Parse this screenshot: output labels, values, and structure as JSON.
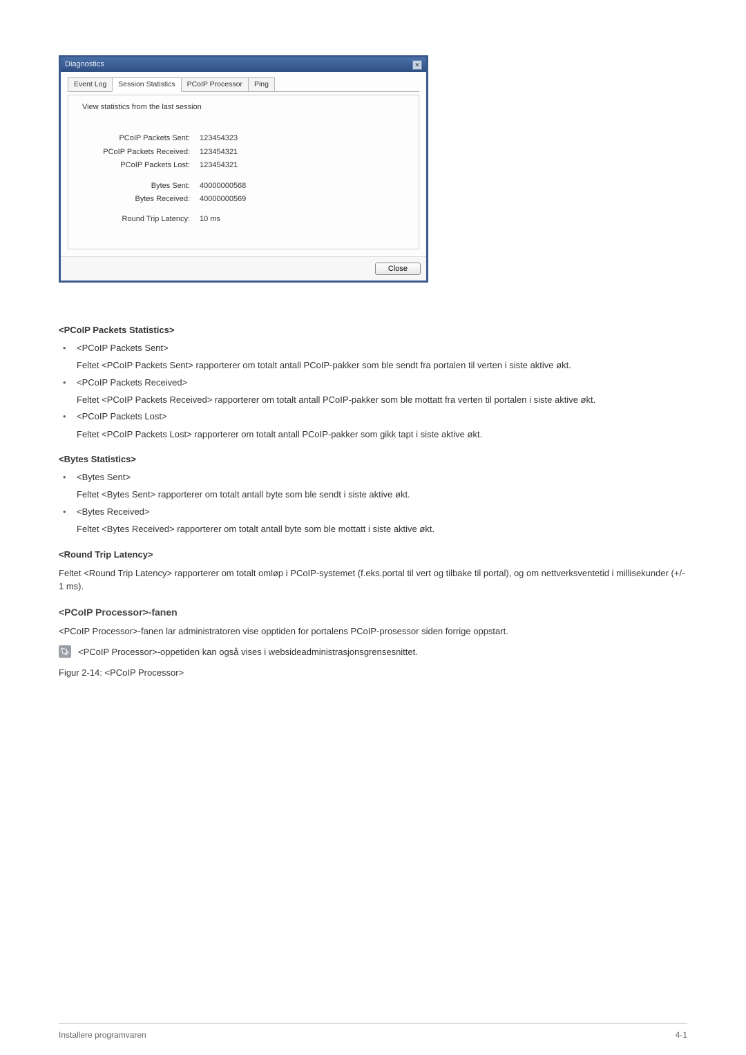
{
  "dialog": {
    "title": "Diagnostics",
    "tabs": [
      "Event Log",
      "Session Statistics",
      "PCoIP Processor",
      "Ping"
    ],
    "active_tab_index": 1,
    "panel_desc": "View statistics from the last session",
    "stats": [
      {
        "label": "PCoIP Packets Sent:",
        "value": "123454323"
      },
      {
        "label": "PCoIP Packets Received:",
        "value": "123454321"
      },
      {
        "label": "PCoIP Packets Lost:",
        "value": "123454321"
      },
      {
        "label": "Bytes Sent:",
        "value": "40000000568"
      },
      {
        "label": "Bytes Received:",
        "value": "40000000569"
      },
      {
        "label": "Round Trip Latency:",
        "value": "10 ms"
      }
    ],
    "close_btn": "Close"
  },
  "doc": {
    "h_pcoip_packets": "<PCoIP Packets Statistics>",
    "pp_sent_title": "<PCoIP Packets Sent>",
    "pp_sent_desc": "Feltet <PCoIP Packets Sent> rapporterer om totalt antall PCoIP-pakker som ble sendt fra portalen til verten i siste aktive økt.",
    "pp_recv_title": "<PCoIP Packets Received>",
    "pp_recv_desc": "Feltet <PCoIP Packets Received> rapporterer om totalt antall PCoIP-pakker som ble mottatt fra verten til portalen i siste aktive økt.",
    "pp_lost_title": "<PCoIP Packets Lost>",
    "pp_lost_desc": "Feltet <PCoIP Packets Lost> rapporterer om totalt antall PCoIP-pakker som gikk tapt i siste aktive økt.",
    "h_bytes": "<Bytes Statistics>",
    "b_sent_title": "<Bytes Sent>",
    "b_sent_desc": "Feltet <Bytes Sent> rapporterer om totalt antall byte som ble sendt i siste aktive økt.",
    "b_recv_title": "<Bytes Received>",
    "b_recv_desc": "Feltet <Bytes Received> rapporterer om totalt antall byte som ble mottatt i siste aktive økt.",
    "h_latency": "<Round Trip Latency>",
    "latency_desc": "Feltet <Round Trip Latency> rapporterer om totalt omløp i PCoIP-systemet (f.eks.portal til vert og tilbake til portal), og om nettverksventetid i millisekunder (+/- 1 ms).",
    "h_processor": "<PCoIP Processor>-fanen",
    "processor_desc": "<PCoIP Processor>-fanen lar administratoren vise opptiden for portalens PCoIP-prosessor siden forrige oppstart.",
    "note_text": "<PCoIP Processor>-oppetiden kan også vises i websideadministrasjonsgrensesnittet.",
    "fig_caption": "Figur 2-14: <PCoIP Processor>"
  },
  "footer": {
    "left": "Installere programvaren",
    "right": "4-1"
  }
}
